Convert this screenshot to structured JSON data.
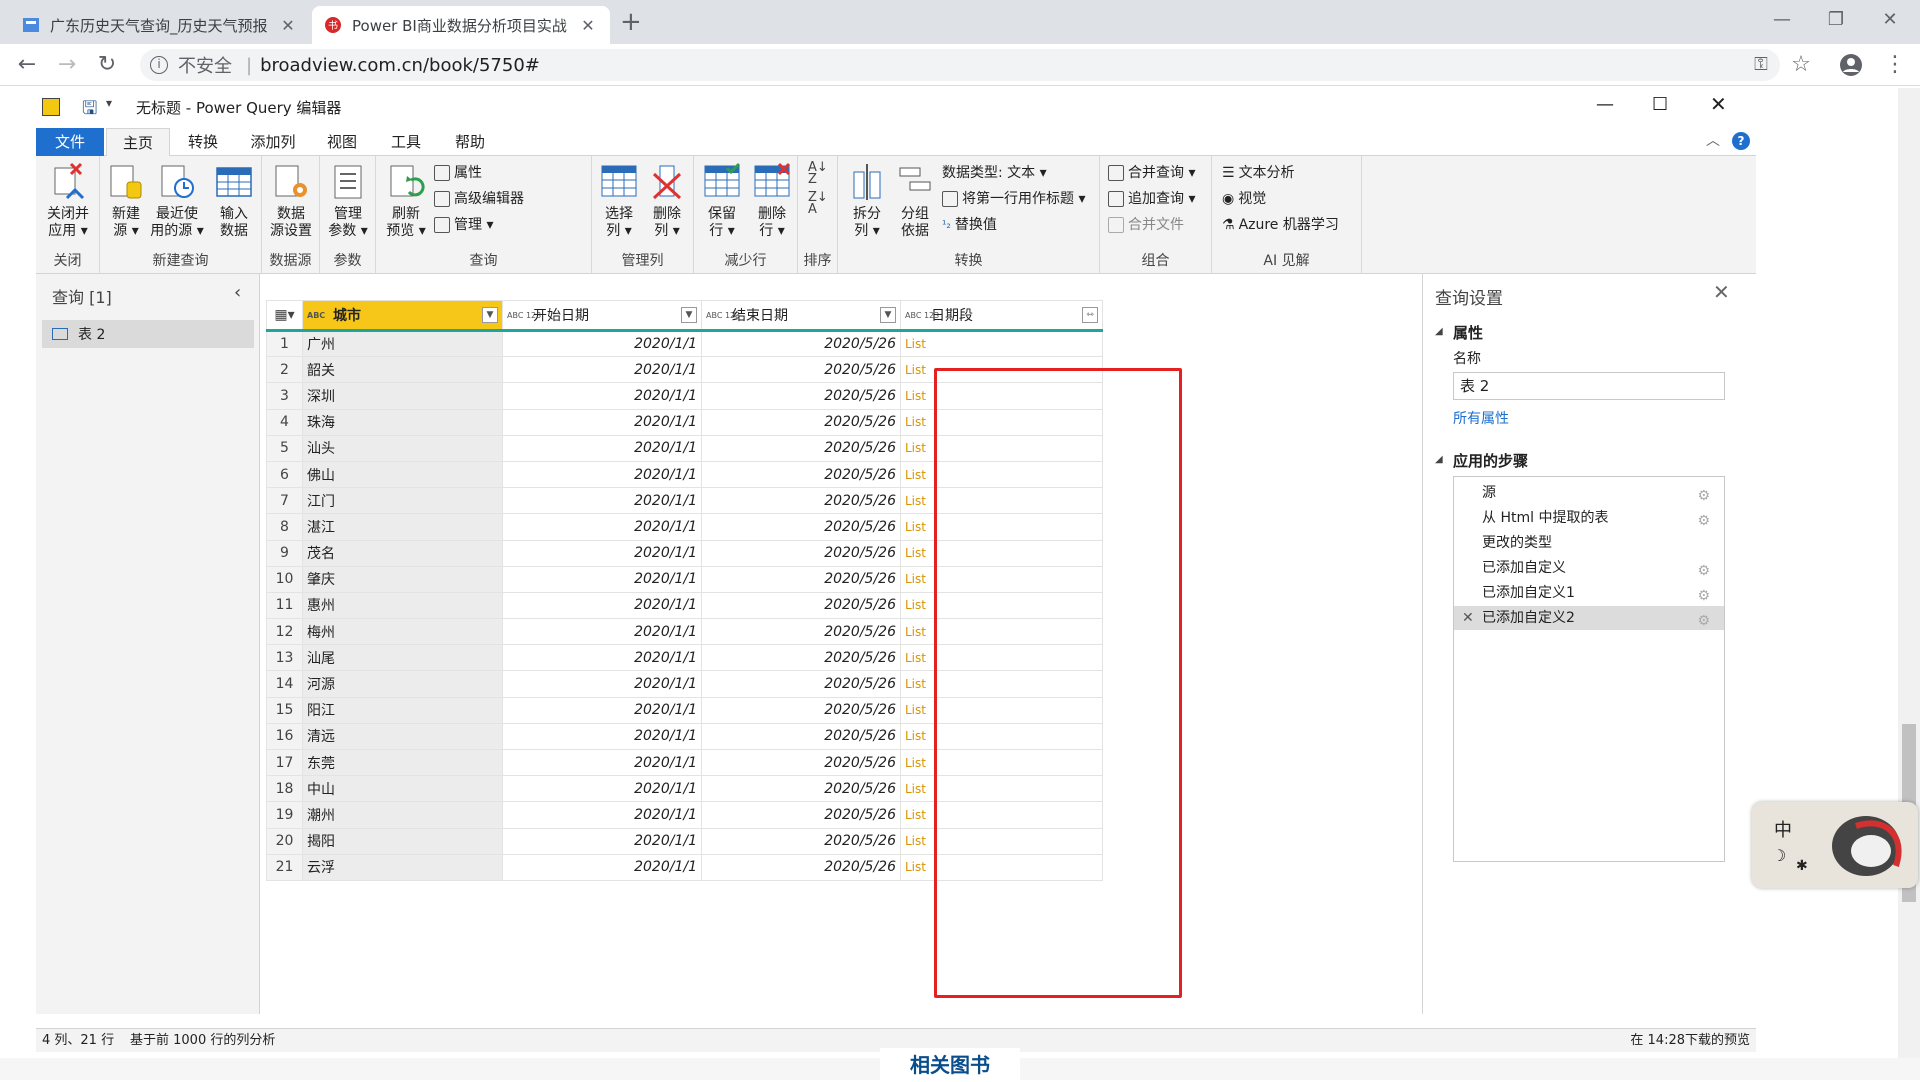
{
  "browser": {
    "tabs": [
      {
        "title": "广东历史天气查询_历史天气预报",
        "active": false
      },
      {
        "title": "Power BI商业数据分析项目实战",
        "active": true
      }
    ],
    "insecure_label": "不安全",
    "url": "broadview.com.cn/book/5750#"
  },
  "app": {
    "title": "无标题 - Power Query 编辑器",
    "ribbon_tabs": [
      "文件",
      "主页",
      "转换",
      "添加列",
      "视图",
      "工具",
      "帮助"
    ],
    "groups": {
      "close": {
        "label": "关闭",
        "btn": "关闭并\n应用"
      },
      "newquery": {
        "label": "新建查询",
        "btn1": "新建\n源",
        "btn2": "最近使\n用的源",
        "btn3": "输入\n数据"
      },
      "datasource": {
        "label": "数据源",
        "btn": "数据\n源设置"
      },
      "params": {
        "label": "参数",
        "btn": "管理\n参数"
      },
      "query": {
        "label": "查询",
        "btn": "刷新\n预览",
        "s1": "属性",
        "s2": "高级编辑器",
        "s3": "管理"
      },
      "managecols": {
        "label": "管理列",
        "btn1": "选择\n列",
        "btn2": "删除\n列"
      },
      "reducerows": {
        "label": "减少行",
        "btn1": "保留\n行",
        "btn2": "删除\n行"
      },
      "sort": {
        "label": "排序"
      },
      "transform": {
        "label": "转换",
        "btn1": "拆分\n列",
        "btn2": "分组\n依据",
        "s1": "数据类型: 文本",
        "s2": "将第一行用作标题",
        "s3": "替换值"
      },
      "combine": {
        "label": "组合",
        "s1": "合并查询",
        "s2": "追加查询",
        "s3": "合并文件"
      },
      "ai": {
        "label": "AI 见解",
        "s1": "文本分析",
        "s2": "视觉",
        "s3": "Azure 机器学习"
      }
    },
    "queries_title": "查询 [1]",
    "query_item": "表 2",
    "columns": [
      "城市",
      "开始日期",
      "结束日期",
      "日期段"
    ],
    "col_type_tag": "ABC 123",
    "col_type_tag_text": "ABC",
    "rows": [
      [
        "1",
        "广州",
        "2020/1/1",
        "2020/5/26",
        "List"
      ],
      [
        "2",
        "韶关",
        "2020/1/1",
        "2020/5/26",
        "List"
      ],
      [
        "3",
        "深圳",
        "2020/1/1",
        "2020/5/26",
        "List"
      ],
      [
        "4",
        "珠海",
        "2020/1/1",
        "2020/5/26",
        "List"
      ],
      [
        "5",
        "汕头",
        "2020/1/1",
        "2020/5/26",
        "List"
      ],
      [
        "6",
        "佛山",
        "2020/1/1",
        "2020/5/26",
        "List"
      ],
      [
        "7",
        "江门",
        "2020/1/1",
        "2020/5/26",
        "List"
      ],
      [
        "8",
        "湛江",
        "2020/1/1",
        "2020/5/26",
        "List"
      ],
      [
        "9",
        "茂名",
        "2020/1/1",
        "2020/5/26",
        "List"
      ],
      [
        "10",
        "肇庆",
        "2020/1/1",
        "2020/5/26",
        "List"
      ],
      [
        "11",
        "惠州",
        "2020/1/1",
        "2020/5/26",
        "List"
      ],
      [
        "12",
        "梅州",
        "2020/1/1",
        "2020/5/26",
        "List"
      ],
      [
        "13",
        "汕尾",
        "2020/1/1",
        "2020/5/26",
        "List"
      ],
      [
        "14",
        "河源",
        "2020/1/1",
        "2020/5/26",
        "List"
      ],
      [
        "15",
        "阳江",
        "2020/1/1",
        "2020/5/26",
        "List"
      ],
      [
        "16",
        "清远",
        "2020/1/1",
        "2020/5/26",
        "List"
      ],
      [
        "17",
        "东莞",
        "2020/1/1",
        "2020/5/26",
        "List"
      ],
      [
        "18",
        "中山",
        "2020/1/1",
        "2020/5/26",
        "List"
      ],
      [
        "19",
        "潮州",
        "2020/1/1",
        "2020/5/26",
        "List"
      ],
      [
        "20",
        "揭阳",
        "2020/1/1",
        "2020/5/26",
        "List"
      ],
      [
        "21",
        "云浮",
        "2020/1/1",
        "2020/5/26",
        "List"
      ]
    ],
    "settings": {
      "title": "查询设置",
      "props_header": "属性",
      "name_label": "名称",
      "name_value": "表 2",
      "all_props": "所有属性",
      "steps_header": "应用的步骤",
      "steps": [
        {
          "label": "源",
          "gear": true
        },
        {
          "label": "从 Html 中提取的表",
          "gear": true
        },
        {
          "label": "更改的类型",
          "gear": false
        },
        {
          "label": "已添加自定义",
          "gear": true
        },
        {
          "label": "已添加自定义1",
          "gear": true
        },
        {
          "label": "已添加自定义2",
          "gear": true,
          "selected": true
        }
      ]
    },
    "status_left": "4 列、21 行",
    "status_mid": "基于前 1000 行的列分析",
    "status_right": "在 14:28下载的预览"
  },
  "page_bottom_text": "相关图书",
  "ime_char": "中",
  "colors": {
    "accent_blue": "#1e6fce",
    "highlight_col": "#f6c719",
    "list_text": "#d89400",
    "annot_red": "#e42020",
    "header_bar": "#1ea69a"
  }
}
